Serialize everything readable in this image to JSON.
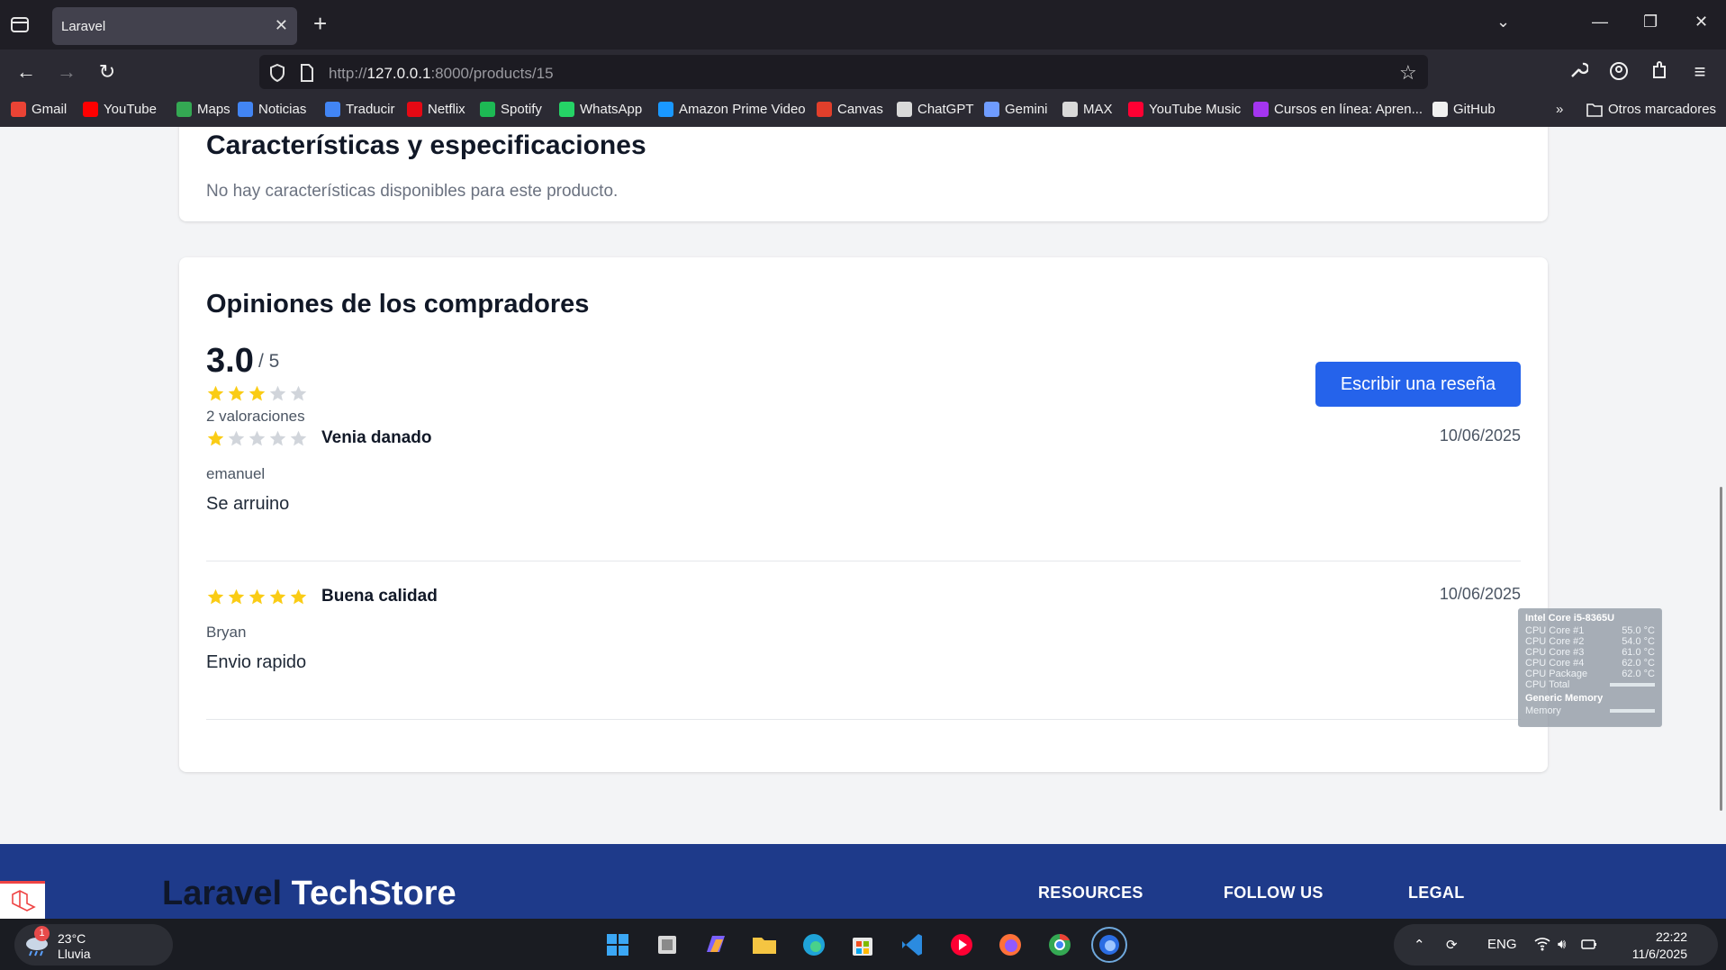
{
  "browser": {
    "tab_title": "Laravel",
    "url_prefix": "http://",
    "url_host": "127.0.0.1",
    "url_path": ":8000/products/15",
    "bookmarks": [
      {
        "label": "Gmail",
        "color": "#ea4335"
      },
      {
        "label": "YouTube",
        "color": "#ff0000"
      },
      {
        "label": "Maps",
        "color": "#34a853"
      },
      {
        "label": "Noticias",
        "color": "#4285f4"
      },
      {
        "label": "Traducir",
        "color": "#4285f4"
      },
      {
        "label": "Netflix",
        "color": "#e50914"
      },
      {
        "label": "Spotify",
        "color": "#1db954"
      },
      {
        "label": "WhatsApp",
        "color": "#25d366"
      },
      {
        "label": "Amazon Prime Video",
        "color": "#1a98ff"
      },
      {
        "label": "Canvas",
        "color": "#e13f2b"
      },
      {
        "label": "ChatGPT",
        "color": "#d9d9d9"
      },
      {
        "label": "Gemini",
        "color": "#6f9cff"
      },
      {
        "label": "MAX",
        "color": "#d9d9d9"
      },
      {
        "label": "YouTube Music",
        "color": "#ff0033"
      },
      {
        "label": "Cursos en línea: Apren...",
        "color": "#a435f0"
      },
      {
        "label": "GitHub",
        "color": "#f0f0f0"
      }
    ],
    "other_bookmarks": "Otros marcadores"
  },
  "page": {
    "spec_title": "Características y especificaciones",
    "spec_empty": "No hay características disponibles para este producto.",
    "reviews_title": "Opiniones de los compradores",
    "average": "3.0",
    "average_max": "/ 5",
    "average_stars": 3,
    "ratings_count": "2 valoraciones",
    "write_review": "Escribir una reseña",
    "reviews": [
      {
        "rating": 1,
        "title": "Venia danado",
        "date": "10/06/2025",
        "author": "emanuel",
        "body": "Se arruino"
      },
      {
        "rating": 5,
        "title": "Buena calidad",
        "date": "10/06/2025",
        "author": "Bryan",
        "body": "Envio rapido"
      }
    ]
  },
  "footer": {
    "logo_part1": "Laravel",
    "logo_part2": " TechStore",
    "resources": "RESOURCES",
    "follow_us": "FOLLOW US",
    "legal": "LEGAL"
  },
  "sensor": {
    "cpu_title": "Intel Core i5-8365U",
    "rows": [
      {
        "label": "CPU Core #1",
        "value": "55.0 °C"
      },
      {
        "label": "CPU Core #2",
        "value": "54.0 °C"
      },
      {
        "label": "CPU Core #3",
        "value": "61.0 °C"
      },
      {
        "label": "CPU Core #4",
        "value": "62.0 °C"
      },
      {
        "label": "CPU Package",
        "value": "62.0 °C"
      }
    ],
    "cpu_total": "CPU Total",
    "mem_title": "Generic Memory",
    "memory": "Memory"
  },
  "taskbar": {
    "weather_badge": "1",
    "temperature": "23°C",
    "weather_desc": "Lluvia",
    "language": "ENG",
    "time": "22:22",
    "date": "11/6/2025"
  },
  "colors": {
    "star_filled": "#facc15",
    "star_empty": "#d1d5db",
    "primary": "#2563eb",
    "footer_bg": "#1e3a8a"
  }
}
